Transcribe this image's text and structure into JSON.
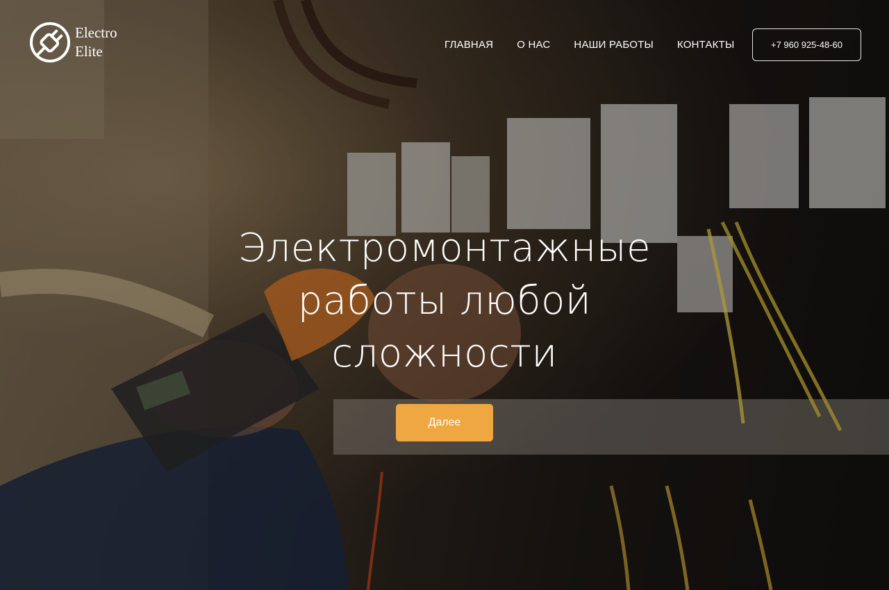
{
  "brand": {
    "line1": "Electro",
    "line2": "Elite",
    "icon": "plug-icon"
  },
  "nav": {
    "items": [
      {
        "label": "ГЛАВНАЯ"
      },
      {
        "label": "О НАС"
      },
      {
        "label": "НАШИ РАБОТЫ"
      },
      {
        "label": "КОНТАКТЫ"
      }
    ]
  },
  "phone": {
    "label": "+7 960 925-48-60"
  },
  "hero": {
    "title_lines": [
      "Электромонтажные",
      "работы любой",
      "сложности"
    ],
    "cta_label": "Далее"
  },
  "colors": {
    "accent": "#efa742",
    "text": "#ffffff"
  }
}
